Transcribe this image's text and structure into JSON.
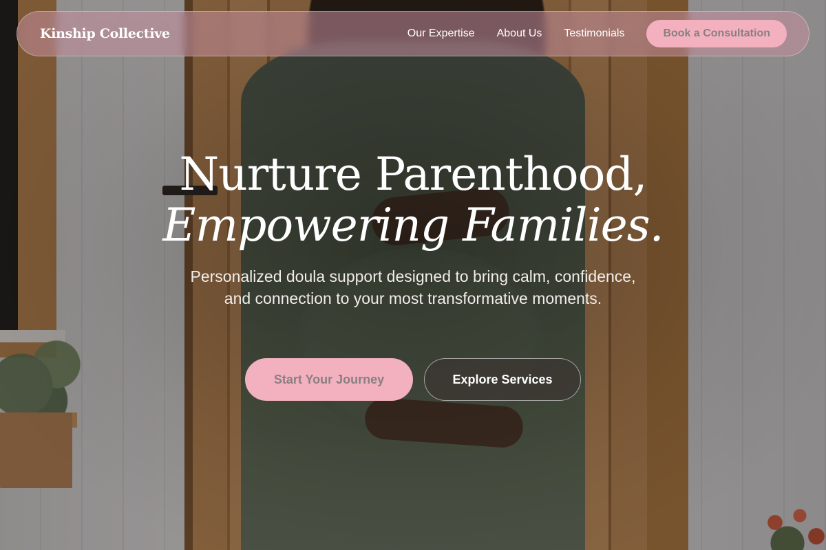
{
  "nav": {
    "brand": "Kinship Collective",
    "links": [
      {
        "label": "Our Expertise"
      },
      {
        "label": "About Us"
      },
      {
        "label": "Testimonials"
      }
    ],
    "cta_label": "Book a Consultation"
  },
  "hero": {
    "title_line1": "Nurture Parenthood,",
    "title_line2": "Empowering Families.",
    "subtitle": "Personalized doula support designed to bring calm, confidence, and connection to your most transformative moments.",
    "primary_button": "Start Your Journey",
    "secondary_button": "Explore Services"
  },
  "colors": {
    "accent_pink": "#f3b1c0",
    "nav_bg": "#c48e9e",
    "button_text_muted": "#8a7f80"
  }
}
